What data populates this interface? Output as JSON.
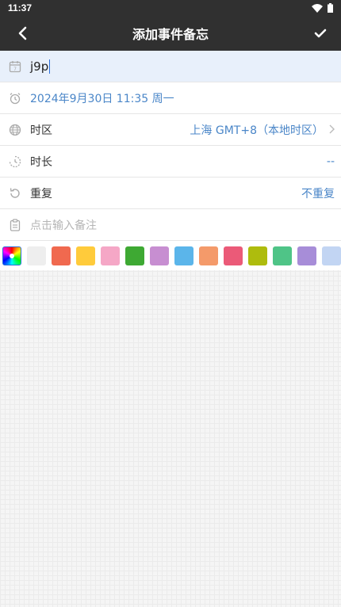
{
  "status_bar": {
    "time": "11:37"
  },
  "app_bar": {
    "title": "添加事件备忘"
  },
  "form": {
    "title_value": "j9p",
    "datetime": "2024年9月30日 11:35 周一",
    "timezone": {
      "label": "时区",
      "value": "上海 GMT+8（本地时区）"
    },
    "duration": {
      "label": "时长",
      "value": "--"
    },
    "repeat": {
      "label": "重复",
      "value": "不重复"
    },
    "note": {
      "placeholder": "点击输入备注"
    }
  },
  "colors": {
    "accent": "#4a86c8",
    "palette": [
      "#eeeeee",
      "#f0694f",
      "#ffcb3b",
      "#f5a7c6",
      "#3ea933",
      "#c78ed1",
      "#5bb5ea",
      "#f49a6a",
      "#eb5a78",
      "#aebc0d",
      "#4fc487",
      "#a78dd8",
      "#c2d5f3"
    ]
  }
}
